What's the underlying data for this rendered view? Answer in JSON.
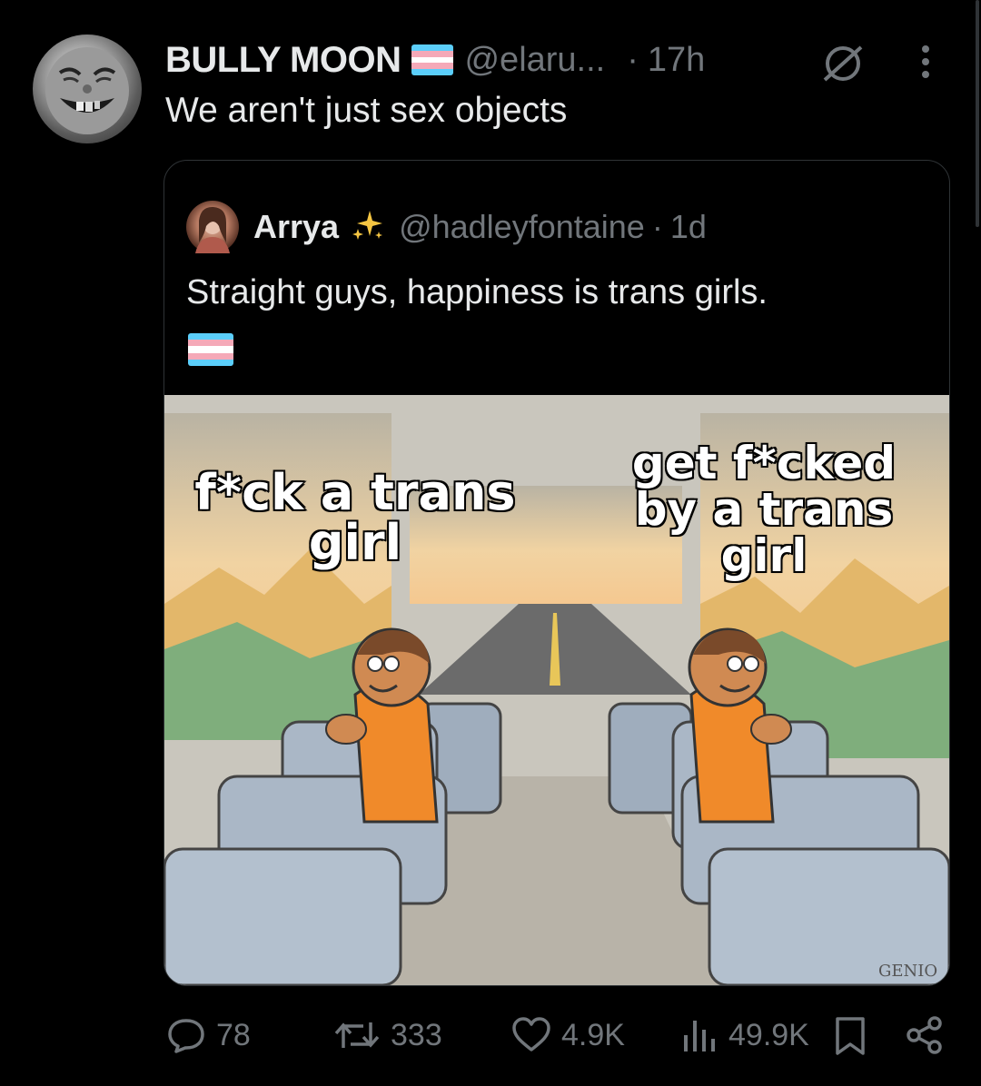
{
  "tweet": {
    "author_name": "BULLY MOON",
    "author_handle": "@elaru...",
    "separator": "·",
    "time": "17h",
    "text": "We aren't just sex objects",
    "avatar_icon": "smiling-face-avatar",
    "flag_icon": "transgender-flag-icon"
  },
  "quote": {
    "author_name": "Arrya",
    "author_sparkle": "✨",
    "author_handle": "@hadleyfontaine",
    "separator": "·",
    "time": "1d",
    "text": "Straight guys, happiness is trans girls.",
    "flag_icon": "transgender-flag-icon",
    "meme": {
      "left_label": "f*ck a trans girl",
      "right_label": "get f*cked by a trans girl",
      "signature": "GENIO"
    }
  },
  "actions": {
    "replies": "78",
    "reposts": "333",
    "likes": "4.9K",
    "views": "49.9K"
  },
  "colors": {
    "background": "#000000",
    "text": "#e7e9ea",
    "muted": "#71767b",
    "border": "#2f3336",
    "flag_blue": "#5BCEFA",
    "flag_pink": "#F5A9B8",
    "flag_white": "#FFFFFF"
  }
}
